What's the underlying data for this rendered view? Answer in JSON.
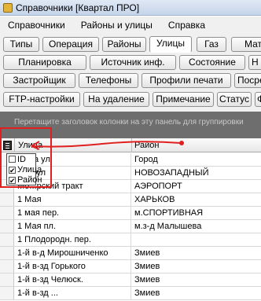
{
  "window": {
    "title": "Справочники [Квартал ПРО]"
  },
  "menu": [
    "Справочники",
    "Районы и улицы",
    "Справка"
  ],
  "toolbar": {
    "row1": [
      "Типы",
      "Операция",
      "Районы",
      "Улицы",
      "Газ",
      "Мат"
    ],
    "row2": [
      "Планировка",
      "Источник инф.",
      "Состояние",
      "Н"
    ],
    "row3": [
      "Застройщик",
      "Телефоны",
      "Профили печати",
      "Посре"
    ],
    "row4": [
      "FTP-настройки",
      "На удаление",
      "Примечание",
      "Статус",
      "Ф"
    ],
    "active": "Улицы"
  },
  "group_panel": {
    "hint": "Перетащите заголовок колонки на эту панель для группировки"
  },
  "grid": {
    "columns": [
      "Улица",
      "Район"
    ],
    "rows": [
      [
        "...ова ул",
        "Город"
      ],
      [
        "...на ул",
        "НОВОЗАПАДНЫЙ"
      ],
      [
        "Мо...рский тракт",
        "АЭРОПОРТ"
      ],
      [
        "1 Мая",
        "ХАРЬКОВ"
      ],
      [
        "1 мая пер.",
        "м.СПОРТИВНАЯ"
      ],
      [
        "1 Мая пл.",
        "м.з-д Малышева"
      ],
      [
        "1 Плодородн. пер.",
        ""
      ],
      [
        "1-й в-д Мирошниченко",
        "Змиев"
      ],
      [
        "1-й в-зд Горького",
        "Змиев"
      ],
      [
        "1-й в-зд Челюск.",
        "Змиев"
      ],
      [
        "1-й в-зд ...",
        "Змиев"
      ]
    ]
  },
  "column_chooser": {
    "items": [
      {
        "label": "ID",
        "checked": false
      },
      {
        "label": "Улица",
        "checked": true
      },
      {
        "label": "Район",
        "checked": true
      }
    ]
  },
  "annotation": {
    "color": "#e02020"
  }
}
